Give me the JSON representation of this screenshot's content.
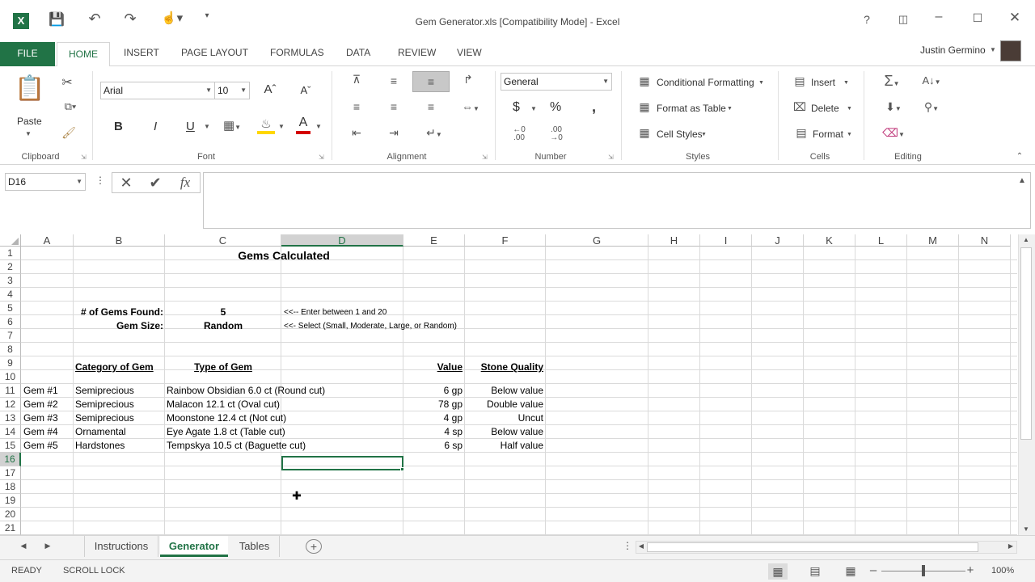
{
  "window": {
    "title": "Gem Generator.xls  [Compatibility Mode] - Excel",
    "user": "Justin Germino",
    "help": "?"
  },
  "ribbon_tabs": [
    "FILE",
    "HOME",
    "INSERT",
    "PAGE LAYOUT",
    "FORMULAS",
    "DATA",
    "REVIEW",
    "VIEW"
  ],
  "groups": {
    "clipboard": "Clipboard",
    "font": "Font",
    "alignment": "Alignment",
    "number": "Number",
    "styles": "Styles",
    "cells": "Cells",
    "editing": "Editing"
  },
  "clipboard": {
    "paste": "Paste"
  },
  "font": {
    "name": "Arial",
    "size": "10",
    "bold": "B",
    "italic": "I",
    "underline": "U"
  },
  "number": {
    "format": "General",
    "currency": "$",
    "percent": "%",
    "comma": ","
  },
  "styles": {
    "conditional": "Conditional Formatting",
    "table": "Format as Table",
    "cell": "Cell Styles"
  },
  "cells": {
    "insert": "Insert",
    "delete": "Delete",
    "format": "Format"
  },
  "formula": {
    "namebox": "D16",
    "fx": "fx",
    "content": ""
  },
  "columns": [
    "A",
    "B",
    "C",
    "D",
    "E",
    "F",
    "G",
    "H",
    "I",
    "J",
    "K",
    "L",
    "M",
    "N"
  ],
  "rows": [
    "1",
    "2",
    "3",
    "4",
    "5",
    "6",
    "7",
    "8",
    "9",
    "10",
    "11",
    "12",
    "13",
    "14",
    "15",
    "16",
    "17",
    "18",
    "19",
    "20",
    "21"
  ],
  "cells_data": {
    "title": "Gems Calculated",
    "r5_label": "# of Gems Found:",
    "r5_value": "5",
    "r5_note": "<<-- Enter between 1 and 20",
    "r6_label": "Gem Size:",
    "r6_value": "Random",
    "r6_note": "<<- Select (Small, Moderate, Large, or Random)",
    "h_category": "Category of Gem",
    "h_type": "Type of Gem",
    "h_value": "Value",
    "h_quality": "Stone Quality",
    "gems": [
      {
        "id": "Gem #1",
        "category": "Semiprecious",
        "type": "Rainbow Obsidian 6.0 ct (Round cut)",
        "value": "6 gp",
        "quality": "Below value"
      },
      {
        "id": "Gem #2",
        "category": "Semiprecious",
        "type": "Malacon 12.1 ct (Oval cut)",
        "value": "78 gp",
        "quality": "Double value"
      },
      {
        "id": "Gem #3",
        "category": "Semiprecious",
        "type": "Moonstone 12.4 ct (Not cut)",
        "value": "4 gp",
        "quality": "Uncut"
      },
      {
        "id": "Gem #4",
        "category": "Ornamental",
        "type": "Eye Agate 1.8 ct (Table cut)",
        "value": "4 sp",
        "quality": "Below value"
      },
      {
        "id": "Gem #5",
        "category": "Hardstones",
        "type": "Tempskya 10.5 ct (Baguette cut)",
        "value": "6 sp",
        "quality": "Half value"
      }
    ]
  },
  "sheets": [
    "Instructions",
    "Generator",
    "Tables"
  ],
  "status": {
    "ready": "READY",
    "scroll": "SCROLL LOCK",
    "zoom": "100%"
  },
  "colors": {
    "accent": "#217346"
  }
}
